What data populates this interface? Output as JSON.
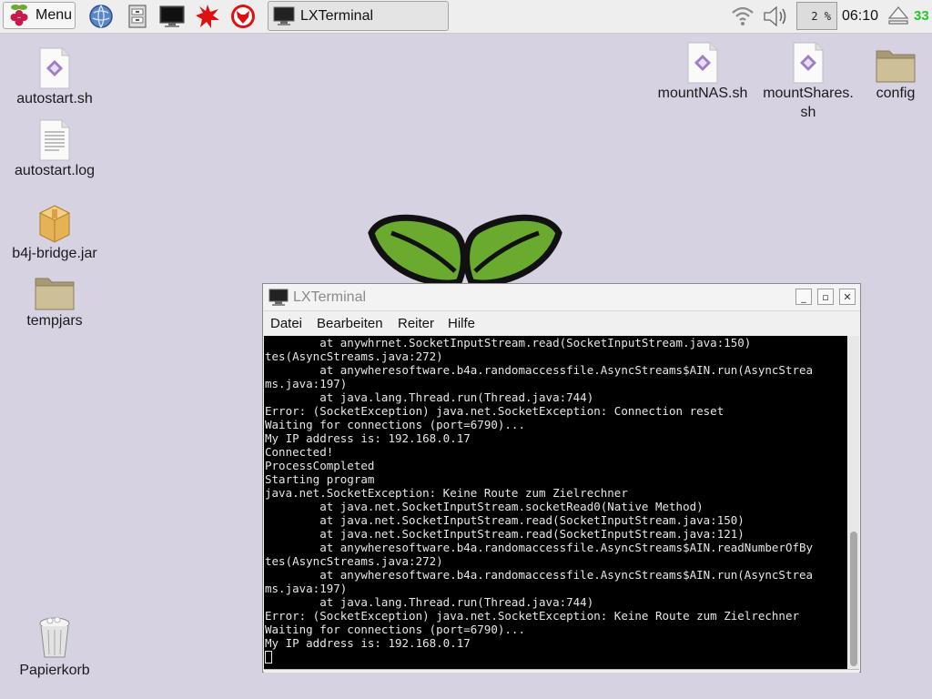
{
  "panel": {
    "menu_label": "Menu",
    "task_title": "LXTerminal",
    "cpu_usage": "2 %",
    "clock": "06:10",
    "temperature": "33",
    "launchers": [
      "globe-browser-icon",
      "file-manager-icon",
      "terminal-icon",
      "wolfram-star-icon",
      "mathematica-wolf-icon"
    ],
    "tray": [
      "wifi-icon",
      "volume-icon",
      "eject-icon"
    ]
  },
  "desktop": {
    "icons": [
      {
        "label": "autostart.sh",
        "type": "script"
      },
      {
        "label": "autostart.log",
        "type": "text"
      },
      {
        "label": "b4j-bridge.jar",
        "type": "archive"
      },
      {
        "label": "tempjars",
        "type": "folder"
      },
      {
        "label": "Papierkorb",
        "type": "trash"
      },
      {
        "label": "mountNAS.sh",
        "type": "script"
      },
      {
        "label": "mountShares.",
        "label2": "sh",
        "type": "script"
      },
      {
        "label": "config",
        "type": "folder"
      }
    ]
  },
  "window": {
    "title": "LXTerminal",
    "menu": [
      "Datei",
      "Bearbeiten",
      "Reiter",
      "Hilfe"
    ],
    "terminal_lines": [
      "        at anywhrnet.SocketInputStream.read(SocketInputStream.java:150)",
      "tes(AsyncStreams.java:272)",
      "        at anywheresoftware.b4a.randomaccessfile.AsyncStreams$AIN.run(AsyncStrea",
      "ms.java:197)",
      "        at java.lang.Thread.run(Thread.java:744)",
      "Error: (SocketException) java.net.SocketException: Connection reset",
      "Waiting for connections (port=6790)...",
      "My IP address is: 192.168.0.17",
      "Connected!",
      "ProcessCompleted",
      "Starting program",
      "java.net.SocketException: Keine Route zum Zielrechner",
      "        at java.net.SocketInputStream.socketRead0(Native Method)",
      "        at java.net.SocketInputStream.read(SocketInputStream.java:150)",
      "        at java.net.SocketInputStream.read(SocketInputStream.java:121)",
      "        at anywheresoftware.b4a.randomaccessfile.AsyncStreams$AIN.readNumberOfBy",
      "tes(AsyncStreams.java:272)",
      "        at anywheresoftware.b4a.randomaccessfile.AsyncStreams$AIN.run(AsyncStrea",
      "ms.java:197)",
      "        at java.lang.Thread.run(Thread.java:744)",
      "Error: (SocketException) java.net.SocketException: Keine Route zum Zielrechner",
      "Waiting for connections (port=6790)...",
      "My IP address is: 192.168.0.17"
    ]
  },
  "colors": {
    "desktop_bg": "#d6d2e2",
    "terminal_bg": "#000000",
    "terminal_fg": "#e6e6e6",
    "leaf_green": "#6aab2f",
    "temperature": "#22cc22"
  }
}
